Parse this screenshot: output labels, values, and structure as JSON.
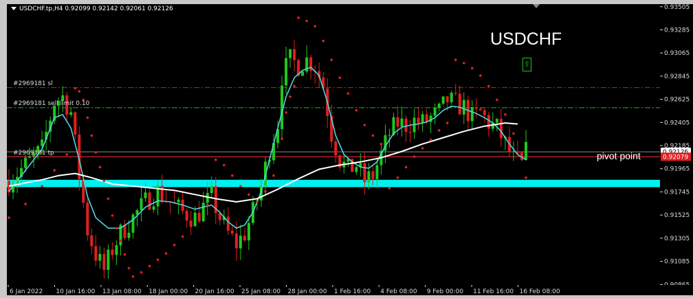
{
  "header": {
    "symbol_line": "USDCHF.tp,H4  0.92099 0.92142 0.92061 0.92126"
  },
  "annotations": {
    "title": "USDCHF",
    "pivot_label": "pivot point",
    "arrow_icon": "up-arrow-icon",
    "order_sl": "#2969181 sl",
    "order_sell_limit": "#2969181 sell limit 0.10",
    "order_tp": "#2969181 tp"
  },
  "price_badges": {
    "current": "0.92126",
    "red": "0.92079"
  },
  "colors": {
    "background": "#000000",
    "bull": "#1fc71f",
    "bear": "#e02020",
    "ema_fast": "#4fd6e0",
    "ema_slow": "#ffffff",
    "psar": "#e02020",
    "zone": "#00f0f0",
    "sl_line": "#d01e1e",
    "limit_line": "#2fb02f",
    "pivot_line": "#ff3030"
  },
  "chart_data": {
    "type": "line",
    "symbol": "USDCHF.tp",
    "timeframe": "H4",
    "ohlc_last": {
      "open": 0.92099,
      "high": 0.92142,
      "low": 0.92061,
      "close": 0.92126
    },
    "y_ticks": [
      "0.93505",
      "0.93285",
      "0.93065",
      "0.92845",
      "0.92625",
      "0.92405",
      "0.92185",
      "0.91965",
      "0.91745",
      "0.91525",
      "0.91305",
      "0.91085",
      "0.90865"
    ],
    "x_ticks": [
      "6 Jan 2022",
      "10 Jan 16:00",
      "13 Jan 08:00",
      "18 Jan 00:00",
      "20 Jan 16:00",
      "25 Jan 08:00",
      "28 Jan 00:00",
      "1 Feb 16:00",
      "4 Feb 08:00",
      "9 Feb 00:00",
      "11 Feb 16:00",
      "16 Feb 08:00"
    ],
    "ylim": [
      0.9088,
      0.9351
    ],
    "close_path": [
      [
        0,
        0.9185
      ],
      [
        4,
        0.92
      ],
      [
        8,
        0.9215
      ],
      [
        11,
        0.926
      ],
      [
        13,
        0.9265
      ],
      [
        15,
        0.925
      ],
      [
        17,
        0.919
      ],
      [
        19,
        0.9138
      ],
      [
        21,
        0.9115
      ],
      [
        23,
        0.91
      ],
      [
        25,
        0.912
      ],
      [
        27,
        0.9135
      ],
      [
        30,
        0.915
      ],
      [
        33,
        0.9165
      ],
      [
        36,
        0.9175
      ],
      [
        39,
        0.9165
      ],
      [
        42,
        0.9155
      ],
      [
        45,
        0.915
      ],
      [
        47,
        0.916
      ],
      [
        49,
        0.917
      ],
      [
        51,
        0.915
      ],
      [
        53,
        0.9135
      ],
      [
        55,
        0.9125
      ],
      [
        57,
        0.9135
      ],
      [
        59,
        0.9155
      ],
      [
        61,
        0.918
      ],
      [
        63,
        0.9215
      ],
      [
        65,
        0.924
      ],
      [
        66,
        0.9285
      ],
      [
        68,
        0.93
      ],
      [
        70,
        0.9295
      ],
      [
        72,
        0.93
      ],
      [
        74,
        0.9295
      ],
      [
        76,
        0.9275
      ],
      [
        78,
        0.923
      ],
      [
        80,
        0.9205
      ],
      [
        82,
        0.9195
      ],
      [
        84,
        0.92
      ],
      [
        86,
        0.9185
      ],
      [
        88,
        0.919
      ],
      [
        90,
        0.921
      ],
      [
        92,
        0.923
      ],
      [
        94,
        0.924
      ],
      [
        96,
        0.9238
      ],
      [
        98,
        0.9242
      ],
      [
        100,
        0.924
      ],
      [
        102,
        0.9245
      ],
      [
        104,
        0.925
      ],
      [
        106,
        0.9262
      ],
      [
        108,
        0.9258
      ],
      [
        110,
        0.9255
      ],
      [
        112,
        0.9245
      ],
      [
        114,
        0.925
      ],
      [
        116,
        0.924
      ],
      [
        118,
        0.9235
      ],
      [
        120,
        0.922
      ],
      [
        122,
        0.9205
      ],
      [
        124,
        0.92
      ],
      [
        125,
        0.9212
      ]
    ],
    "series": [
      {
        "name": "",
        "values": [
          [
            0,
            0.9175
          ],
          [
            4,
            0.9195
          ],
          [
            8,
            0.9215
          ],
          [
            11,
            0.9245
          ],
          [
            13,
            0.9248
          ],
          [
            15,
            0.9235
          ],
          [
            17,
            0.9205
          ],
          [
            19,
            0.917
          ],
          [
            21,
            0.915
          ],
          [
            24,
            0.914
          ],
          [
            27,
            0.914
          ],
          [
            30,
            0.9148
          ],
          [
            33,
            0.916
          ],
          [
            36,
            0.9166
          ],
          [
            39,
            0.9165
          ],
          [
            42,
            0.9162
          ],
          [
            45,
            0.9158
          ],
          [
            47,
            0.916
          ],
          [
            49,
            0.9162
          ],
          [
            51,
            0.9155
          ],
          [
            53,
            0.9146
          ],
          [
            55,
            0.914
          ],
          [
            57,
            0.9143
          ],
          [
            59,
            0.9155
          ],
          [
            61,
            0.9175
          ],
          [
            63,
            0.9205
          ],
          [
            65,
            0.9235
          ],
          [
            67,
            0.9265
          ],
          [
            69,
            0.9283
          ],
          [
            71,
            0.929
          ],
          [
            73,
            0.9293
          ],
          [
            75,
            0.9285
          ],
          [
            77,
            0.926
          ],
          [
            79,
            0.9228
          ],
          [
            81,
            0.921
          ],
          [
            83,
            0.9203
          ],
          [
            85,
            0.9198
          ],
          [
            87,
            0.9197
          ],
          [
            89,
            0.9203
          ],
          [
            91,
            0.9218
          ],
          [
            93,
            0.923
          ],
          [
            95,
            0.9236
          ],
          [
            97,
            0.9238
          ],
          [
            99,
            0.9239
          ],
          [
            101,
            0.9241
          ],
          [
            103,
            0.9245
          ],
          [
            105,
            0.9252
          ],
          [
            107,
            0.9256
          ],
          [
            109,
            0.9255
          ],
          [
            111,
            0.9252
          ],
          [
            113,
            0.9249
          ],
          [
            115,
            0.9245
          ],
          [
            117,
            0.924
          ],
          [
            119,
            0.9232
          ],
          [
            121,
            0.922
          ],
          [
            123,
            0.921
          ],
          [
            125,
            0.9205
          ]
        ]
      },
      {
        "name": "",
        "values": [
          [
            0,
            0.918
          ],
          [
            4,
            0.9183
          ],
          [
            8,
            0.9186
          ],
          [
            12,
            0.919
          ],
          [
            16,
            0.9192
          ],
          [
            20,
            0.9188
          ],
          [
            25,
            0.9182
          ],
          [
            30,
            0.918
          ],
          [
            35,
            0.9178
          ],
          [
            40,
            0.9176
          ],
          [
            45,
            0.9172
          ],
          [
            50,
            0.9168
          ],
          [
            55,
            0.9165
          ],
          [
            60,
            0.9168
          ],
          [
            65,
            0.9177
          ],
          [
            70,
            0.9187
          ],
          [
            75,
            0.9196
          ],
          [
            80,
            0.92
          ],
          [
            85,
            0.9203
          ],
          [
            90,
            0.9207
          ],
          [
            95,
            0.9213
          ],
          [
            100,
            0.922
          ],
          [
            105,
            0.9226
          ],
          [
            110,
            0.9232
          ],
          [
            115,
            0.9237
          ],
          [
            120,
            0.924
          ],
          [
            123,
            0.9239
          ]
        ]
      }
    ],
    "psar": [
      [
        0,
        0.915
      ],
      [
        4,
        0.9163
      ],
      [
        8,
        0.918
      ],
      [
        11,
        0.9195
      ],
      [
        14,
        0.921
      ],
      [
        16,
        0.9273
      ],
      [
        17,
        0.927
      ],
      [
        18,
        0.9262
      ],
      [
        19,
        0.9245
      ],
      [
        20,
        0.9228
      ],
      [
        21,
        0.9212
      ],
      [
        22,
        0.9198
      ],
      [
        23,
        0.9185
      ],
      [
        24,
        0.9168
      ],
      [
        25,
        0.9152
      ],
      [
        26,
        0.914
      ],
      [
        27,
        0.9128
      ],
      [
        28,
        0.9115
      ],
      [
        29,
        0.9102
      ],
      [
        30,
        0.9094
      ],
      [
        32,
        0.9098
      ],
      [
        34,
        0.9104
      ],
      [
        36,
        0.911
      ],
      [
        38,
        0.9116
      ],
      [
        40,
        0.9124
      ],
      [
        42,
        0.9132
      ],
      [
        44,
        0.9142
      ],
      [
        46,
        0.9152
      ],
      [
        48,
        0.9162
      ],
      [
        50,
        0.9205
      ],
      [
        52,
        0.92
      ],
      [
        54,
        0.919
      ],
      [
        56,
        0.918
      ],
      [
        58,
        0.9172
      ],
      [
        60,
        0.9165
      ],
      [
        62,
        0.9175
      ],
      [
        64,
        0.919
      ],
      [
        66,
        0.9225
      ],
      [
        67,
        0.925
      ],
      [
        68,
        0.9265
      ],
      [
        69,
        0.9275
      ],
      [
        70,
        0.934
      ],
      [
        72,
        0.9337
      ],
      [
        74,
        0.9332
      ],
      [
        76,
        0.9318
      ],
      [
        78,
        0.93
      ],
      [
        80,
        0.9283
      ],
      [
        82,
        0.9268
      ],
      [
        84,
        0.9252
      ],
      [
        86,
        0.9238
      ],
      [
        88,
        0.9228
      ],
      [
        90,
        0.922
      ],
      [
        92,
        0.9178
      ],
      [
        94,
        0.9188
      ],
      [
        96,
        0.9198
      ],
      [
        98,
        0.9208
      ],
      [
        100,
        0.9216
      ],
      [
        102,
        0.9224
      ],
      [
        104,
        0.9233
      ],
      [
        106,
        0.924
      ],
      [
        108,
        0.93
      ],
      [
        110,
        0.9297
      ],
      [
        112,
        0.9292
      ],
      [
        114,
        0.9285
      ],
      [
        116,
        0.9275
      ],
      [
        118,
        0.9262
      ],
      [
        120,
        0.9248
      ],
      [
        122,
        0.923
      ],
      [
        124,
        0.9212
      ],
      [
        125,
        0.9188
      ]
    ],
    "horizontal_lines": [
      {
        "label": "#2969181 sl",
        "value": 0.92736,
        "style": "dash-dot"
      },
      {
        "label": "#2969181 sell limit 0.10",
        "value": 0.92545,
        "style": "dash-dot"
      },
      {
        "label": "",
        "value": 0.92126,
        "style": "solid"
      },
      {
        "label": "#2969181 tp",
        "value": 0.92079,
        "style": "solid"
      }
    ],
    "support_zone": [
      0.9179,
      0.9186
    ]
  }
}
